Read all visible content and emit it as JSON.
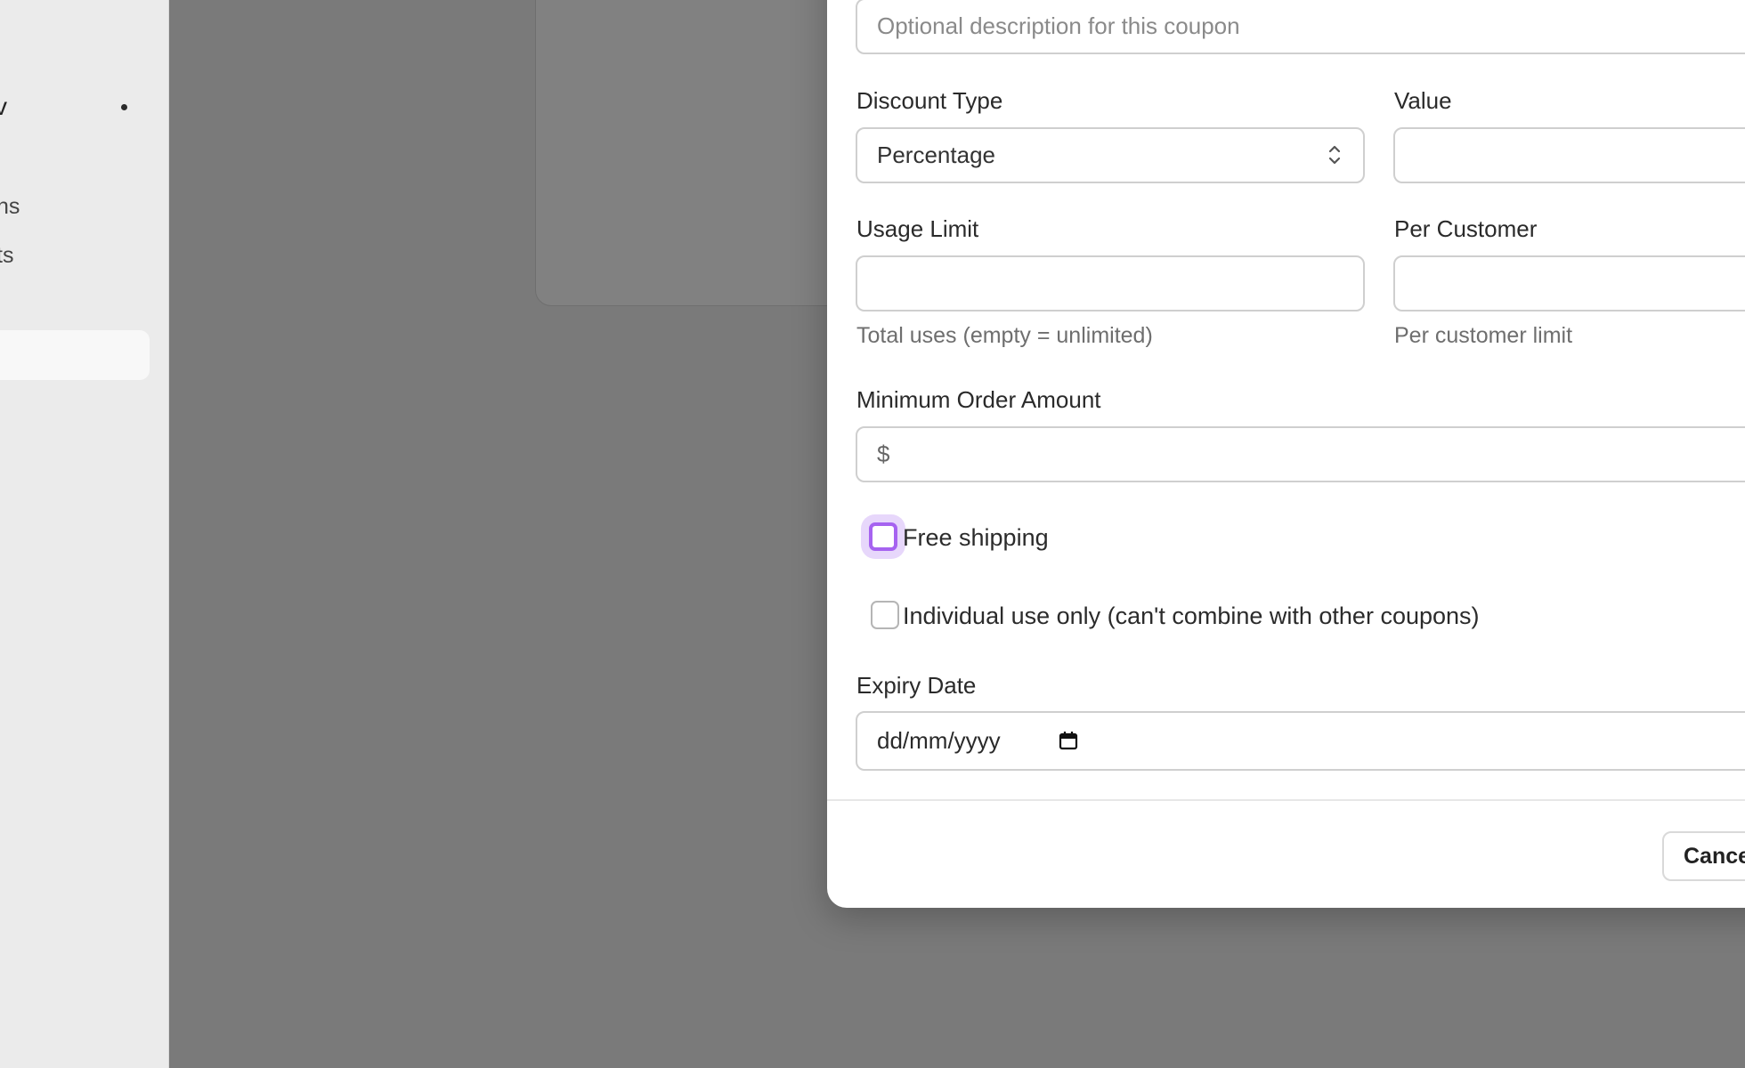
{
  "sidebar": {
    "title_fragment": "v",
    "items": [
      {
        "label": "ns"
      },
      {
        "label": "ts"
      }
    ]
  },
  "modal": {
    "description": {
      "placeholder": "Optional description for this coupon"
    },
    "discount_type": {
      "label": "Discount Type",
      "value": "Percentage"
    },
    "value": {
      "label": "Value",
      "value": ""
    },
    "usage_limit": {
      "label": "Usage Limit",
      "value": "",
      "hint": "Total uses (empty = unlimited)"
    },
    "per_customer": {
      "label": "Per Customer",
      "value": "",
      "hint": "Per customer limit"
    },
    "min_order": {
      "label": "Minimum Order Amount",
      "prefix": "$",
      "value": ""
    },
    "free_shipping": {
      "label": "Free shipping",
      "checked": false
    },
    "individual_use": {
      "label": "Individual use only (can't combine with other coupons)",
      "checked": false
    },
    "expiry": {
      "label": "Expiry Date",
      "placeholder": "dd/mm/yyyy"
    },
    "cancel_label": "Cance"
  },
  "colors": {
    "overlay": "#7a7a7a",
    "focus_accent": "#a663f0",
    "sidebar_bg": "#ebebeb"
  }
}
